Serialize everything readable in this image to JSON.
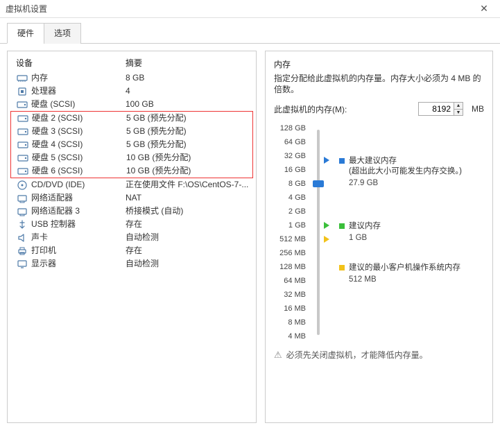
{
  "window": {
    "title": "虚拟机设置"
  },
  "tabs": {
    "hardware": "硬件",
    "options": "选项"
  },
  "device_headers": {
    "device": "设备",
    "summary": "摘要"
  },
  "devices": [
    {
      "icon": "memory-icon",
      "name": "内存",
      "summary": "8 GB"
    },
    {
      "icon": "cpu-icon",
      "name": "处理器",
      "summary": "4"
    },
    {
      "icon": "disk-icon",
      "name": "硬盘 (SCSI)",
      "summary": "100 GB"
    }
  ],
  "devices_highlighted": [
    {
      "icon": "disk-icon",
      "name": "硬盘 2 (SCSI)",
      "summary": "5 GB (预先分配)"
    },
    {
      "icon": "disk-icon",
      "name": "硬盘 3 (SCSI)",
      "summary": "5 GB (预先分配)"
    },
    {
      "icon": "disk-icon",
      "name": "硬盘 4 (SCSI)",
      "summary": "5 GB (预先分配)"
    },
    {
      "icon": "disk-icon",
      "name": "硬盘 5 (SCSI)",
      "summary": "10 GB (预先分配)"
    },
    {
      "icon": "disk-icon",
      "name": "硬盘 6 (SCSI)",
      "summary": "10 GB (预先分配)"
    }
  ],
  "devices_after": [
    {
      "icon": "cd-icon",
      "name": "CD/DVD (IDE)",
      "summary": "正在使用文件 F:\\OS\\CentOS-7-..."
    },
    {
      "icon": "nic-icon",
      "name": "网络适配器",
      "summary": "NAT"
    },
    {
      "icon": "nic-icon",
      "name": "网络适配器 3",
      "summary": "桥接模式 (自动)"
    },
    {
      "icon": "usb-icon",
      "name": "USB 控制器",
      "summary": "存在"
    },
    {
      "icon": "sound-icon",
      "name": "声卡",
      "summary": "自动检测"
    },
    {
      "icon": "printer-icon",
      "name": "打印机",
      "summary": "存在"
    },
    {
      "icon": "display-icon",
      "name": "显示器",
      "summary": "自动检测"
    }
  ],
  "memory_panel": {
    "group_title": "内存",
    "desc": "指定分配给此虚拟机的内存量。内存大小必须为 4 MB 的倍数。",
    "label": "此虚拟机的内存(M):",
    "value": "8192",
    "unit": "MB",
    "ticks": [
      "128 GB",
      "64 GB",
      "32 GB",
      "16 GB",
      "8 GB",
      "4 GB",
      "2 GB",
      "1 GB",
      "512 MB",
      "256 MB",
      "128 MB",
      "64 MB",
      "32 MB",
      "16 MB",
      "8 MB",
      "4 MB"
    ],
    "legend": {
      "max_rec": {
        "title": "最大建议内存",
        "sub": "(超出此大小可能发生内存交换。)",
        "value": "27.9 GB"
      },
      "rec": {
        "title": "建议内存",
        "value": "1 GB"
      },
      "min_rec": {
        "title": "建议的最小客户机操作系统内存",
        "value": "512 MB"
      }
    },
    "warning": "必须先关闭虚拟机，才能降低内存量。"
  }
}
